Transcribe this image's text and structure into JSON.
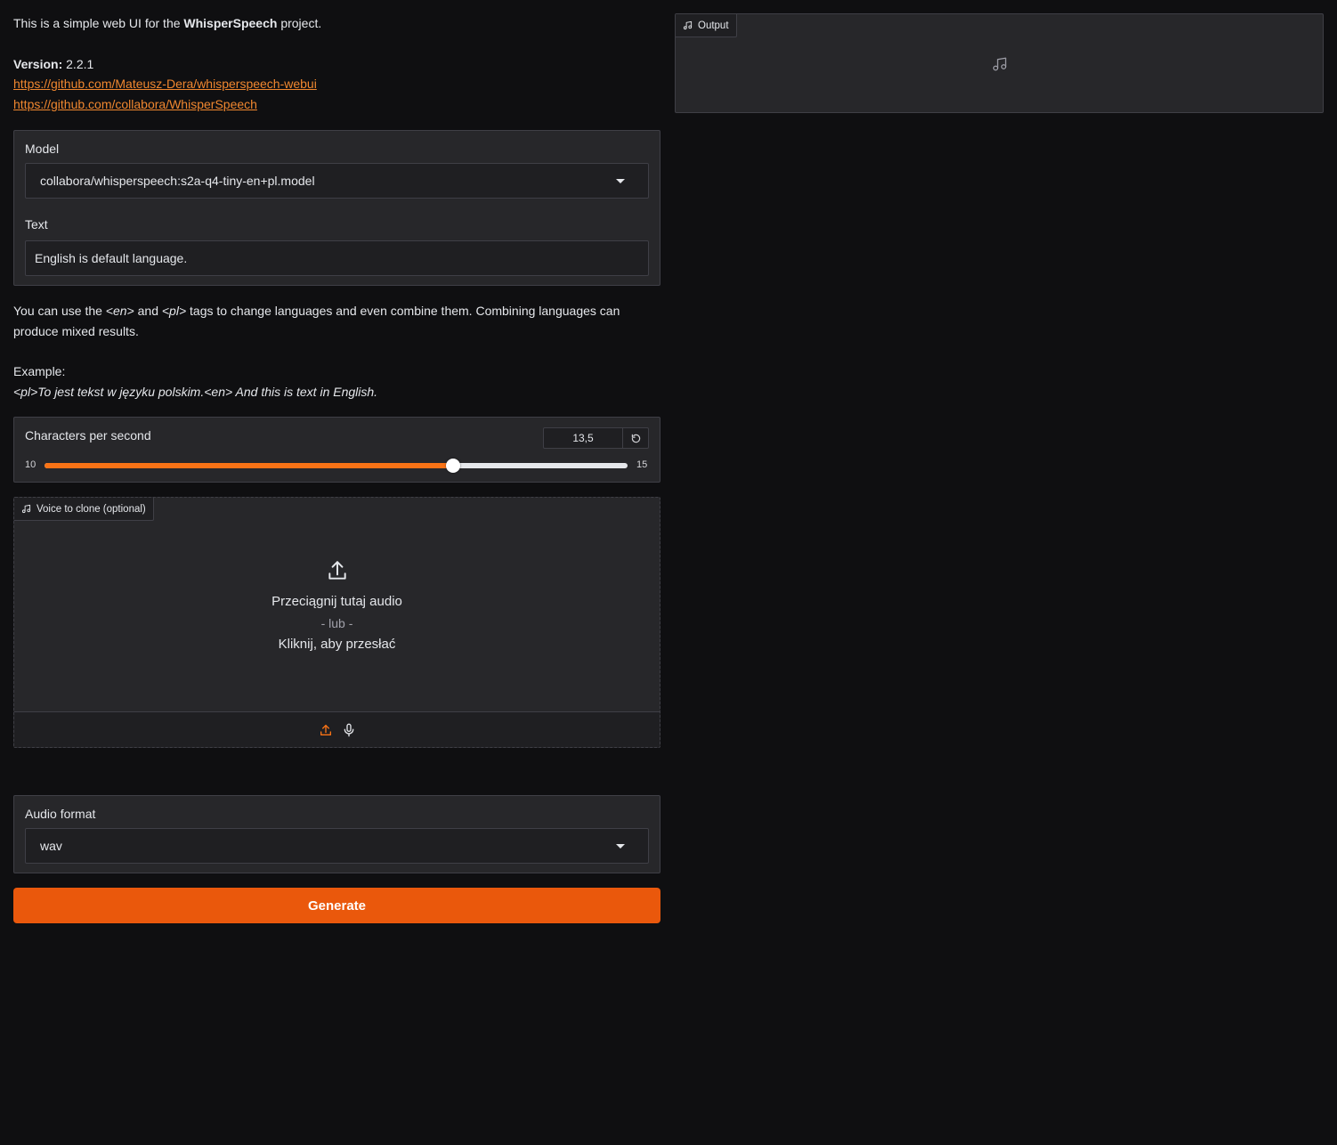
{
  "intro": {
    "line_prefix": "This is a simple web UI for the ",
    "project_name": "WhisperSpeech",
    "line_suffix": " project.",
    "version_label": "Version:",
    "version_value": " 2.2.1",
    "link_webui": "https://github.com/Mateusz-Dera/whisperspeech-webui",
    "link_repo": "https://github.com/collabora/WhisperSpeech"
  },
  "model": {
    "label": "Model",
    "selected": "collabora/whisperspeech:s2a-q4-tiny-en+pl.model"
  },
  "text": {
    "label": "Text",
    "value": "English is default language."
  },
  "help": {
    "p1_a": "You can use the ",
    "tag_en": "<en>",
    "p1_b": " and ",
    "tag_pl": "<pl>",
    "p1_c": " tags to change languages and even combine them. Combining languages can produce mixed results.",
    "example_label": "Example:",
    "example_text": "<pl>To jest tekst w języku polskim.<en> And this is text in English."
  },
  "slider": {
    "label": "Characters per second",
    "value_text": "13,5",
    "value": 13.5,
    "min": 10,
    "max": 15,
    "reset_icon": "reset-icon"
  },
  "voice": {
    "label": "Voice to clone (optional)",
    "drop_main": "Przeciągnij tutaj audio",
    "drop_or": "- lub -",
    "drop_click": "Kliknij, aby przesłać"
  },
  "audio_format": {
    "label": "Audio format",
    "selected": "wav"
  },
  "generate": {
    "label": "Generate"
  },
  "output": {
    "label": "Output"
  },
  "colors": {
    "accent": "#ea580c",
    "slider_fill": "#f97316",
    "link": "#f0872f",
    "panel": "#27272a",
    "background": "#0f0f11"
  }
}
